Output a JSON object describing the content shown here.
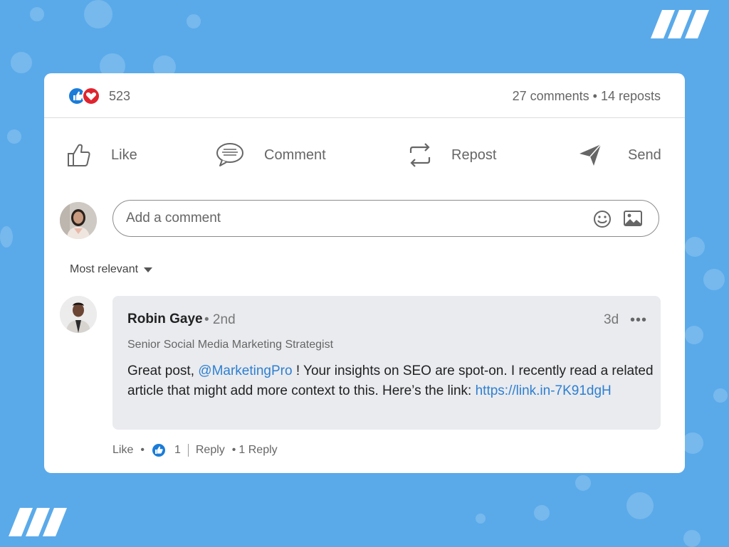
{
  "brand": {
    "logo_icon": "slash-stripes-logo"
  },
  "post_stats": {
    "reaction_count": "523",
    "comments_reposts": "27 comments • 14 reposts",
    "reaction_icons": [
      "like-reaction-icon",
      "love-reaction-icon"
    ]
  },
  "actions": [
    {
      "label": "Like",
      "icon": "thumbs-up-icon"
    },
    {
      "label": "Comment",
      "icon": "comment-bubble-icon"
    },
    {
      "label": "Repost",
      "icon": "repost-arrows-icon"
    },
    {
      "label": "Send",
      "icon": "send-plane-icon"
    }
  ],
  "composer": {
    "placeholder": "Add a comment"
  },
  "sort": {
    "label": "Most relevant"
  },
  "comment": {
    "author": "Robin Gaye",
    "degree": "• 2nd",
    "time": "3d",
    "more": "•••",
    "headline": "Senior Social Media Marketing Strategist",
    "text_before": "Great post, ",
    "mention": "@MarketingPro",
    "text_after": " ! Your insights on SEO are spot-on. I recently read a related article that might add more context to this. Here’s the link: ",
    "link": "https://link.in-7K91dgH",
    "footer": {
      "like_label": "Like",
      "like_count": "1",
      "reply_label": "Reply",
      "replies_label": "1 Reply"
    }
  },
  "colors": {
    "background": "#5aaaea",
    "accent": "#2f7fd0",
    "love": "#e0242e",
    "like": "#1a7cd8"
  }
}
